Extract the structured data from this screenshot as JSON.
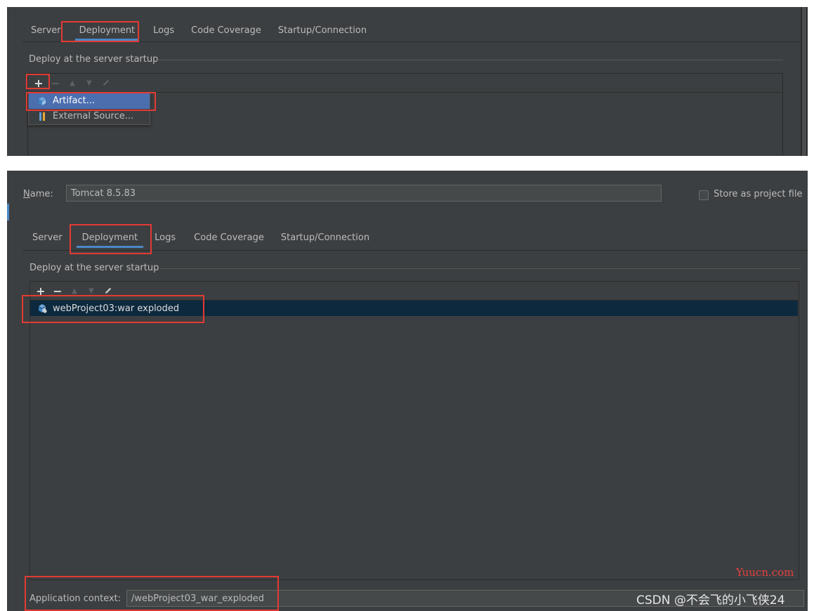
{
  "top_panel": {
    "tabs": [
      "Server",
      "Deployment",
      "Logs",
      "Code Coverage",
      "Startup/Connection"
    ],
    "active_tab": "Deployment",
    "group_title": "Deploy at the server startup",
    "toolbar": {
      "add": "+",
      "remove": "−",
      "up": "▲",
      "down": "▼"
    },
    "popup_items": [
      {
        "label": "Artifact...",
        "icon": "artifact-icon"
      },
      {
        "label": "External Source...",
        "icon": "external-source-icon"
      }
    ]
  },
  "bottom_panel": {
    "name_label": "Name:",
    "name_value": "Tomcat 8.5.83",
    "store_label": "Store as project file",
    "tabs": [
      "Server",
      "Deployment",
      "Logs",
      "Code Coverage",
      "Startup/Connection"
    ],
    "active_tab": "Deployment",
    "group_title": "Deploy at the server startup",
    "toolbar": {
      "add": "+",
      "remove": "−",
      "up": "▲",
      "down": "▼"
    },
    "deployment_item": {
      "label": "webProject03:war exploded",
      "icon": "artifact-icon"
    },
    "app_context_label": "Application context:",
    "app_context_value": "/webProject03_war_exploded"
  },
  "watermarks": {
    "site": "Yuucn.com",
    "author": "CSDN @不会飞的小飞侠24"
  },
  "colors": {
    "panel_bg": "#3c3f41",
    "highlight": "#e33a34",
    "selection": "#4b6eaf",
    "row_selection": "#0d293e",
    "tab_underline": "#4a88c7"
  }
}
